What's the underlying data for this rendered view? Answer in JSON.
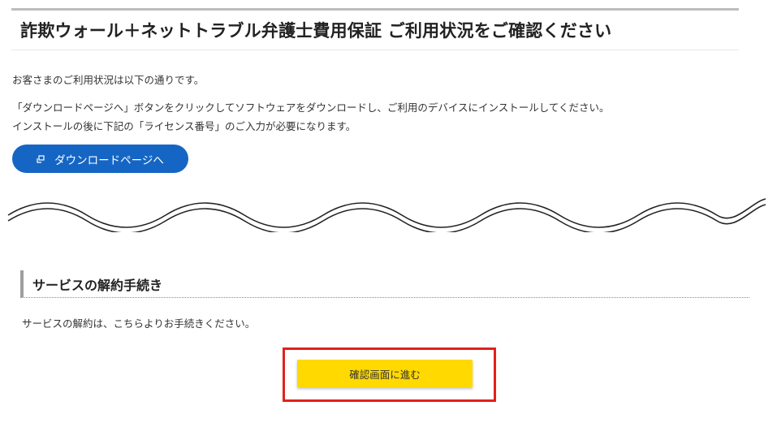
{
  "page_title": "詐欺ウォール＋ネットトラブル弁護士費用保証 ご利用状況をご確認ください",
  "intro": {
    "line1": "お客さまのご利用状況は以下の通りです。",
    "line2": "「ダウンロードページへ」ボタンをクリックしてソフトウェアをダウンロードし、ご利用のデバイスにインストールしてください。",
    "line3": "インストールの後に下記の「ライセンス番号」のご入力が必要になります。"
  },
  "download_button": {
    "label": "ダウンロードページへ",
    "icon": "external-window-icon",
    "color": "#1566c4"
  },
  "cancel_section": {
    "heading": "サービスの解約手続き",
    "description": "サービスの解約は、こちらよりお手続きください。",
    "button_label": "確認画面に進む",
    "button_color": "#ffd900",
    "highlight_color": "#e3201b"
  }
}
